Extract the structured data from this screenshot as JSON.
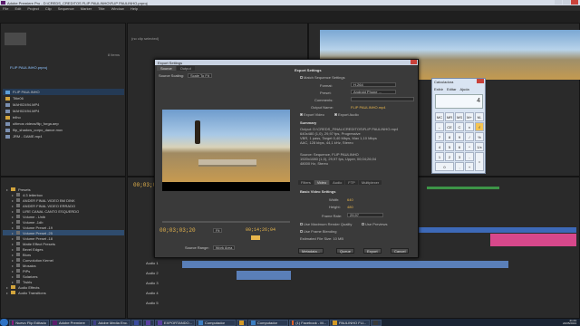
{
  "window": {
    "title": "Adobe Premiere Pro - D:\\CREDS_CREDITOS FLIP PAULINHO\\FLIP PAULINHO.prproj",
    "menu": [
      "File",
      "Edit",
      "Project",
      "Clip",
      "Sequence",
      "Marker",
      "Title",
      "Window",
      "Help"
    ]
  },
  "source_panel": {
    "no_clip": "(no clip selected)"
  },
  "project": {
    "name": "FLIP PAULINHO.prproj",
    "count": "8 Items",
    "items": [
      {
        "label": "FLIP PAULINHO",
        "kind": "seq"
      },
      {
        "label": "Title06",
        "kind": "bin"
      },
      {
        "label": "MAH02494.MP4",
        "kind": "media"
      },
      {
        "label": "MAH02494.MP4",
        "kind": "media"
      },
      {
        "label": "trilho",
        "kind": "bin"
      },
      {
        "label": "ultimos videos/flip_forga.aep",
        "kind": "media"
      },
      {
        "label": "flip_shadow_corpo_dance.mov",
        "kind": "media"
      },
      {
        "label": "JRM - GAME.mp4",
        "kind": "media"
      }
    ]
  },
  "effects": {
    "items": [
      {
        "label": "Presets",
        "child": false,
        "sel": false
      },
      {
        "label": "4:3 letterbox",
        "child": true,
        "sel": false
      },
      {
        "label": "ANDER FINAL VIDEO BM DINK",
        "child": true,
        "sel": false
      },
      {
        "label": "ANDER FINAL VIDEO ERRADO",
        "child": true,
        "sel": false
      },
      {
        "label": "LIRE CANAL CANTO ESQUERDO",
        "child": true,
        "sel": false
      },
      {
        "label": "Volume - Unib",
        "child": true,
        "sel": false
      },
      {
        "label": "Volume -1db",
        "child": true,
        "sel": false
      },
      {
        "label": "Volume Preset -19",
        "child": true,
        "sel": false
      },
      {
        "label": "Volume Preset -25",
        "child": true,
        "sel": true
      },
      {
        "label": "Volume Preset -18",
        "child": true,
        "sel": false
      },
      {
        "label": "Matte Effect Presets",
        "child": true,
        "sel": false
      },
      {
        "label": "Bevel Edges",
        "child": true,
        "sel": false
      },
      {
        "label": "Blurs",
        "child": true,
        "sel": false
      },
      {
        "label": "Convolution Kernel",
        "child": true,
        "sel": false
      },
      {
        "label": "Mosaics",
        "child": true,
        "sel": false
      },
      {
        "label": "PiPs",
        "child": true,
        "sel": false
      },
      {
        "label": "Solarizes",
        "child": true,
        "sel": false
      },
      {
        "label": "Twirls",
        "child": true,
        "sel": false
      },
      {
        "label": "Audio Effects",
        "child": false,
        "sel": false
      },
      {
        "label": "Audio Transitions",
        "child": false,
        "sel": false
      }
    ]
  },
  "timeline": {
    "timecode": "00;03;03;20",
    "tracks": [
      "Audio 1",
      "Audio 2",
      "Audio 3",
      "Audio 4",
      "Audio 5"
    ]
  },
  "export": {
    "title": "Export Settings",
    "tabs": [
      "Source",
      "Output"
    ],
    "source_scaling_label": "Source Scaling:",
    "source_scaling": "Scale To Fit",
    "timecode_in": "00;03;03;20",
    "fit": "Fit",
    "timecode_out": "00;14;26;04",
    "source_range_label": "Source Range:",
    "source_range": "Work Area",
    "settings": {
      "heading": "Export Settings",
      "match_sequence": "Match Sequence Settings",
      "format_label": "Format:",
      "format": "H.264",
      "preset_label": "Preset:",
      "preset": "Android Phone ...",
      "comments_label": "Comments:",
      "output_name_label": "Output Name:",
      "output_name": "FLIP PAULINHO.mp4",
      "export_video": "Export Video",
      "export_audio": "Export Audio",
      "summary_heading": "Summary",
      "summary_output": "Output: D:\\CREDS_FINAL\\CREDITOS\\FLIP PAULINHO.mp4\n640x480 (1,0), 29,97 fps, Progressive\nVBR, 1 pass, Target 0,40 Mbps, Max 1,10 Mbps\nAAC, 128 kbps, 44,1 kHz, Stereo",
      "summary_source": "Source: Sequence, FLIP PAULINHO\n1920x1080 (1,0), 29,97 fps, Upper, 00;04;26;04\n48000 Hz, Stereo"
    },
    "sub_tabs": [
      "Filters",
      "Video",
      "Audio",
      "FTP",
      "Multiplexer"
    ],
    "basic_video": {
      "heading": "Basic Video Settings",
      "width_label": "Width:",
      "width": "640",
      "height_label": "Height:",
      "height": "480",
      "frame_rate_label": "Frame Rate:",
      "frame_rate": "29,97"
    },
    "max_render": "Use Maximum Render Quality",
    "use_previews": "Use Previews",
    "frame_blending": "Use Frame Blending",
    "file_size": "Estimated File Size: 10 MB",
    "buttons": {
      "metadata": "Metadata...",
      "queue": "Queue",
      "export": "Export",
      "cancel": "Cancel"
    }
  },
  "calculator": {
    "title": "Calculadora",
    "menu": [
      "Exibir",
      "Editar",
      "Ajuda"
    ],
    "display": "4",
    "keys": [
      "MC",
      "MR",
      "MS",
      "M+",
      "M-",
      "←",
      "CE",
      "C",
      "±",
      "√",
      "7",
      "8",
      "9",
      "/",
      "%",
      "4",
      "5",
      "6",
      "*",
      "1/x",
      "1",
      "2",
      "3",
      "-",
      "=",
      "0",
      ",",
      "+"
    ]
  },
  "taskbar": {
    "items": [
      {
        "label": "Nuevo Flip Editado",
        "color": "#8a1c7c"
      },
      {
        "label": "Adobe Premiere",
        "color": "#5a1d6b"
      },
      {
        "label": "Adobe Media Enc.",
        "color": "#3f3f86"
      },
      {
        "label": "",
        "color": "#3a4b9e"
      },
      {
        "label": "",
        "color": "#5a3fa0"
      },
      {
        "label": "EXPORTANDO...",
        "color": "#5a3fa0"
      },
      {
        "label": "Computador",
        "color": "#3c7ec2"
      },
      {
        "label": "",
        "color": "#d49a26"
      },
      {
        "label": "Computador",
        "color": "#3c7ec2"
      },
      {
        "label": "(1) Facebook - M...",
        "color": "#e0602a"
      },
      {
        "label": "PAULINHO FLI...",
        "color": "#d49a26"
      },
      {
        "label": "",
        "color": "#3a3a3a"
      }
    ],
    "time": "21:43",
    "date": "24/05/2013"
  }
}
